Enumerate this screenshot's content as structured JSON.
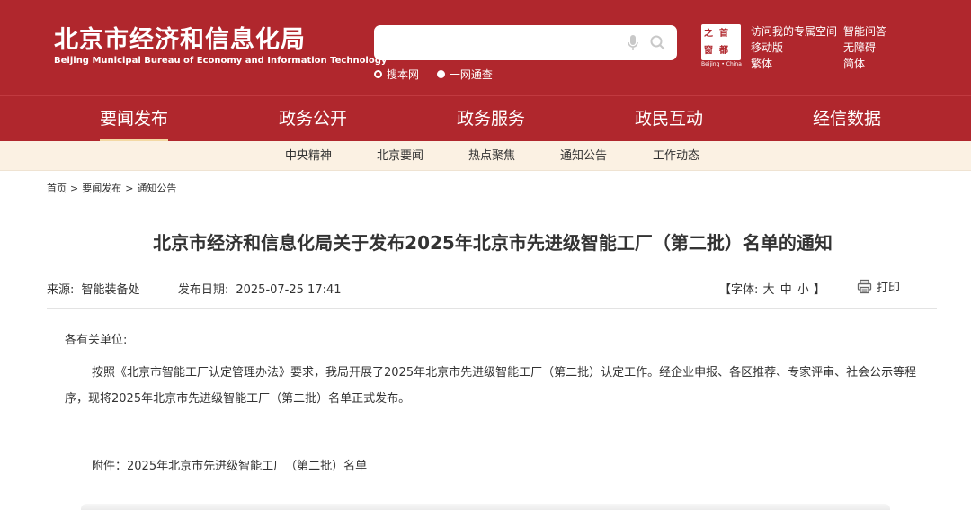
{
  "header": {
    "logo_cn": "北京市经济和信息化局",
    "logo_en": "Beijing Municipal Bureau of Economy and Information Technology",
    "search": {
      "placeholder": "",
      "value": ""
    },
    "search_options": [
      "搜本网",
      "一网通查"
    ],
    "capital_logo": {
      "chars": [
        "之",
        "首",
        "窗",
        "都"
      ],
      "en": "Beijing • China"
    },
    "links_col1": [
      "访问我的专属空间",
      "移动版",
      "繁体"
    ],
    "links_col2": [
      "智能问答",
      "无障碍",
      "简体"
    ],
    "colors": {
      "primary": "#b0272d",
      "subnav_bg": "#fbf1e3"
    }
  },
  "main_nav": [
    "要闻发布",
    "政务公开",
    "政务服务",
    "政民互动",
    "经信数据"
  ],
  "sub_nav": [
    "中央精神",
    "北京要闻",
    "热点聚焦",
    "通知公告",
    "工作动态"
  ],
  "breadcrumb": [
    "首页",
    "要闻发布",
    "通知公告"
  ],
  "article": {
    "title": "北京市经济和信息化局关于发布2025年北京市先进级智能工厂（第二批）名单的通知",
    "source_label": "来源:",
    "source": "智能装备处",
    "date_label": "发布日期:",
    "date": "2025-07-25 17:41",
    "font_label_open": "【字体:",
    "font_sizes": [
      "大",
      "中",
      "小"
    ],
    "font_label_close": "】",
    "print_label": "打印",
    "salutation": "各有关单位:",
    "paragraph": "按照《北京市智能工厂认定管理办法》要求，我局开展了2025年北京市先进级智能工厂（第二批）认定工作。经企业申报、各区推荐、专家评审、社会公示等程序，现将2025年北京市先进级智能工厂（第二批）名单正式发布。",
    "attachment": "附件：2025年北京市先进级智能工厂（第二批）名单"
  }
}
